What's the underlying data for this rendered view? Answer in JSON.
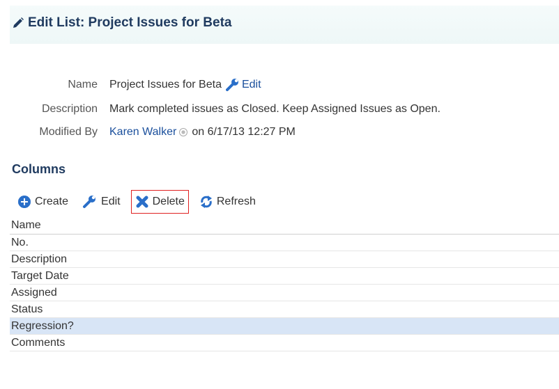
{
  "header": {
    "title": "Edit List: Project Issues for Beta",
    "icon": "pencil-icon"
  },
  "properties": {
    "name_label": "Name",
    "name_value": "Project Issues for Beta",
    "edit_link": "Edit",
    "description_label": "Description",
    "description_value": "Mark completed issues as Closed. Keep Assigned Issues as Open.",
    "modified_label": "Modified By",
    "modified_user": "Karen Walker",
    "modified_on": "on 6/17/13 12:27 PM"
  },
  "columns_section": {
    "title": "Columns"
  },
  "toolbar": {
    "create_label": "Create",
    "edit_label": "Edit",
    "delete_label": "Delete",
    "refresh_label": "Refresh"
  },
  "table": {
    "header": "Name",
    "rows": [
      "No.",
      "Description",
      "Target Date",
      "Assigned",
      "Status",
      "Regression?",
      "Comments"
    ],
    "selected_row": "Regression?"
  },
  "colors": {
    "title": "#1f3a5f",
    "link": "#1a4f9c",
    "selected_row": "#d8e5f6",
    "delete_highlight": "#e02020",
    "icon_blue": "#2a6fc9"
  }
}
